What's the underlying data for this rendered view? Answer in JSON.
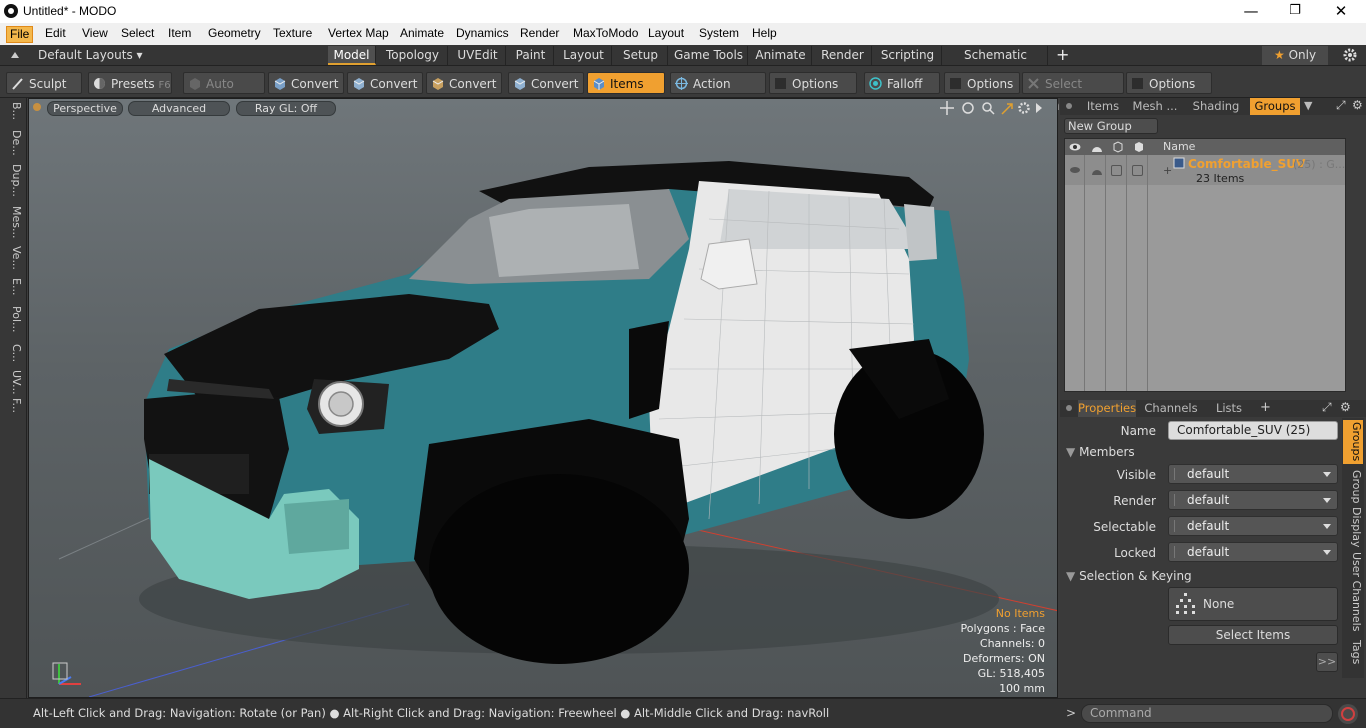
{
  "window": {
    "title": "Untitled* - MODO",
    "minimize": "—",
    "maximize": "❐",
    "close": "✕"
  },
  "menubar": [
    "File",
    "Edit",
    "View",
    "Select",
    "Item",
    "Geometry",
    "Texture",
    "Vertex Map",
    "Animate",
    "Dynamics",
    "Render",
    "MaxToModo",
    "Layout",
    "System",
    "Help"
  ],
  "layoutbar": {
    "layouts_label": "Default Layouts",
    "tabs": [
      "Model",
      "Topology",
      "UVEdit",
      "Paint",
      "Layout",
      "Setup",
      "Game Tools",
      "Animate",
      "Render",
      "Scripting",
      "Schematic Fusion"
    ],
    "selected_tab": "Model",
    "add": "+",
    "only_label": "Only",
    "only_star": "★"
  },
  "toolbar": {
    "sculpt": "Sculpt",
    "presets": "Presets",
    "presets_key": "F6",
    "auto_select": "Auto Select",
    "convert1": "Convert",
    "convert2": "Convert",
    "convert3": "Convert",
    "convert4": "Convert",
    "items": "Items",
    "action_center": "Action Center",
    "options1": "Options",
    "falloff": "Falloff",
    "options2": "Options",
    "select_through": "Select Through",
    "options3": "Options"
  },
  "leftstrip": [
    "B...",
    "De...",
    "Dup...",
    "Mes...",
    "Ve...",
    "E...",
    "Pol...",
    "C...",
    "UV...",
    "F..."
  ],
  "viewport": {
    "perspective": "Perspective",
    "advanced": "Advanced",
    "raygl": "Ray GL: Off",
    "info": {
      "no_items": "No Items",
      "polygons": "Polygons : Face",
      "channels": "Channels: 0",
      "deformers": "Deformers: ON",
      "gl": "GL: 518,405",
      "scale": "100 mm"
    },
    "colors": {
      "no_items": "#f0a030",
      "teal": "#2f7d88",
      "white_part": "#e8e8e8"
    }
  },
  "groups_panel": {
    "tabs": [
      "Items",
      "Mesh ...",
      "Shading",
      "Groups"
    ],
    "selected_tab": "Groups",
    "new_group": "New Group",
    "name_header": "Name",
    "group": {
      "name": "Comfortable_SUV",
      "suffix": "(25) : G...",
      "count": "23 Items"
    }
  },
  "properties_panel": {
    "tabs": [
      "Properties",
      "Channels",
      "Lists"
    ],
    "add": "+",
    "name_label": "Name",
    "name_value": "Comfortable_SUV (25)",
    "members_section": "Members",
    "rows": [
      {
        "label": "Visible",
        "value": "default"
      },
      {
        "label": "Render",
        "value": "default"
      },
      {
        "label": "Selectable",
        "value": "default"
      },
      {
        "label": "Locked",
        "value": "default"
      }
    ],
    "selection_section": "Selection & Keying",
    "none_button": "None",
    "select_items": "Select Items",
    "expand": ">>",
    "side_tabs": [
      "Groups",
      "Group Display",
      "User Channels",
      "Tags"
    ]
  },
  "statusbar": {
    "hint": "Alt-Left Click and Drag: Navigation: Rotate (or Pan) ● Alt-Right Click and Drag: Navigation: Freewheel ● Alt-Middle Click and Drag: navRoll",
    "command_placeholder": "Command",
    "prompt": ">"
  }
}
